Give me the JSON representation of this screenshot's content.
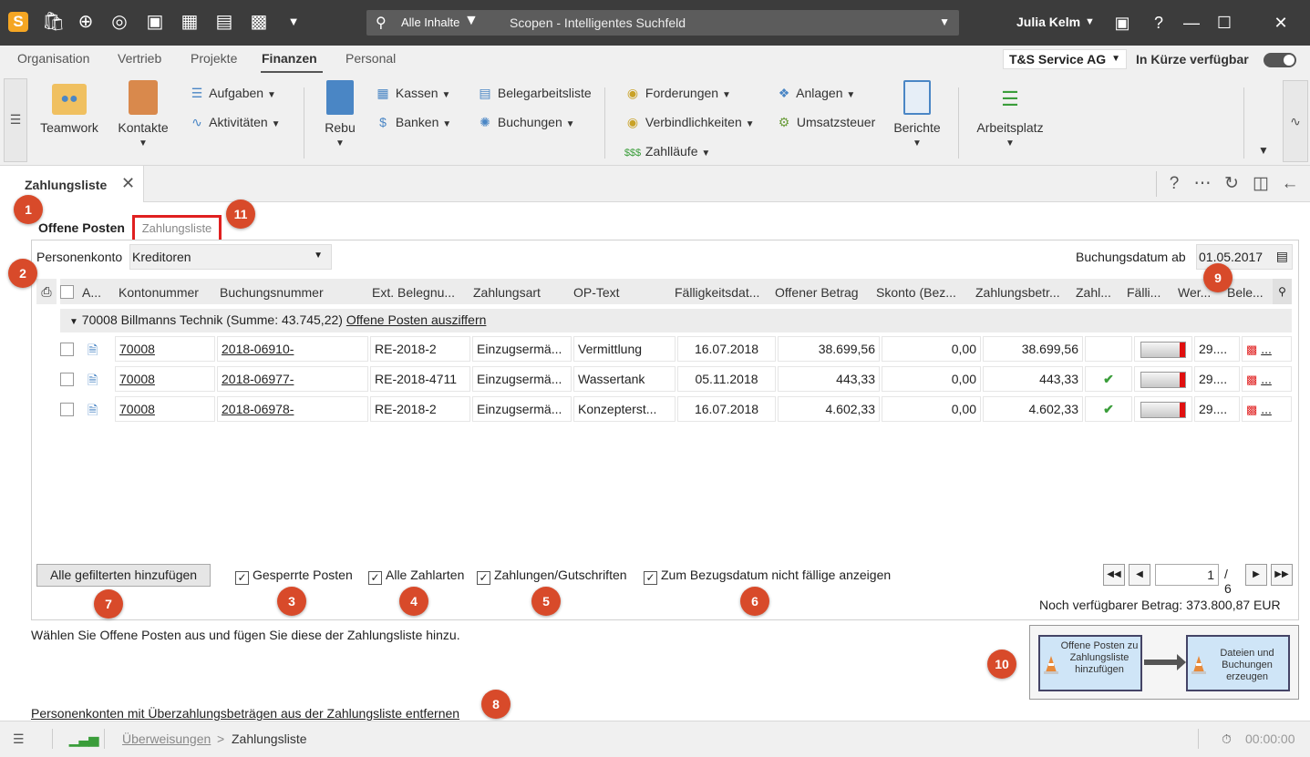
{
  "titlebar": {
    "logo": "S",
    "icons": [
      "bag-icon",
      "plus-circle-icon",
      "lifebuoy-icon",
      "camera-icon",
      "calendar-add-icon",
      "calendar-icon",
      "window-add-icon",
      "dropdown-icon"
    ],
    "search": {
      "scope": "Alle Inhalte",
      "placeholder": "Scopen - Intelligentes Suchfeld"
    },
    "user": "Julia Kelm"
  },
  "navtabs": [
    "Organisation",
    "Vertrieb",
    "Projekte",
    "Finanzen",
    "Personal"
  ],
  "active_navtab": "Finanzen",
  "company": "T&S Service AG",
  "availability": "In Kürze verfügbar",
  "ribbon": {
    "teamwork": "Teamwork",
    "kontakte": "Kontakte",
    "aufgaben": "Aufgaben",
    "aktivitaeten": "Aktivitäten",
    "rebu": "Rebu",
    "kassen": "Kassen",
    "banken": "Banken",
    "belegarbeitsliste": "Belegarbeitsliste",
    "buchungen": "Buchungen",
    "forderungen": "Forderungen",
    "verbindlichkeiten": "Verbindlichkeiten",
    "zahllaeufe": "Zahlläufe",
    "anlagen": "Anlagen",
    "umsatzsteuer": "Umsatzsteuer",
    "berichte": "Berichte",
    "arbeitsplatz": "Arbeitsplatz"
  },
  "doctab": {
    "title": "Zahlungsliste"
  },
  "subtabs": {
    "offene_posten": "Offene Posten",
    "zahlungsliste": "Zahlungsliste"
  },
  "filters": {
    "personenkonto_label": "Personenkonto",
    "personenkonto_value": "Kreditoren",
    "buchungsdatum_label": "Buchungsdatum ab",
    "buchungsdatum_value": "01.05.2017"
  },
  "grid": {
    "headers": [
      "A...",
      "Kontonummer",
      "Buchungsnummer",
      "Ext. Belegnu...",
      "Zahlungsart",
      "OP-Text",
      "Fälligkeitsdat...",
      "Offener Betrag",
      "Skonto (Bez...",
      "Zahlungsbetr...",
      "Zahl...",
      "Fälli...",
      "Wer...",
      "Bele..."
    ],
    "group": {
      "label": "70008 Billmanns Technik (Summe: 43.745,22)",
      "action": "Offene Posten ausziffern"
    },
    "rows": [
      {
        "konto": "70008",
        "buchung": "2018-06910-",
        "beleg": "RE-2018-2",
        "zahlungsart": "Einzugsermä...",
        "optext": "Vermittlung",
        "faellig": "16.07.2018",
        "offen": "38.699,56",
        "skonto": "0,00",
        "zahlung": "38.699,56",
        "zahl": "",
        "wert": "29....",
        "bele": "..."
      },
      {
        "konto": "70008",
        "buchung": "2018-06977-",
        "beleg": "RE-2018-4711",
        "zahlungsart": "Einzugsermä...",
        "optext": "Wassertank",
        "faellig": "05.11.2018",
        "offen": "443,33",
        "skonto": "0,00",
        "zahlung": "443,33",
        "zahl": "✔",
        "wert": "29....",
        "bele": "..."
      },
      {
        "konto": "70008",
        "buchung": "2018-06978-",
        "beleg": "RE-2018-2",
        "zahlungsart": "Einzugsermä...",
        "optext": "Konzepterst...",
        "faellig": "16.07.2018",
        "offen": "4.602,33",
        "skonto": "0,00",
        "zahlung": "4.602,33",
        "zahl": "✔",
        "wert": "29....",
        "bele": "..."
      }
    ]
  },
  "actions": {
    "add_filtered": "Alle gefilterten hinzufügen",
    "gesperrte": "Gesperrte Posten",
    "alle_zahlarten": "Alle Zahlarten",
    "zahlungen": "Zahlungen/Gutschriften",
    "nicht_faellige": "Zum Bezugsdatum nicht fällige anzeigen"
  },
  "pager": {
    "page": "1",
    "total": "/ 6"
  },
  "rest": "Noch verfügbarer Betrag: 373.800,87 EUR",
  "hint": "Wählen Sie Offene Posten aus und fügen Sie diese der Zahlungsliste hinzu.",
  "remove_link": "Personenkonten mit Überzahlungsbeträgen aus der Zahlungsliste entfernen",
  "flow": {
    "step1": "Offene Posten zu Zahlungsliste hinzufügen",
    "step2": "Dateien und Buchungen erzeugen"
  },
  "badges": [
    "1",
    "2",
    "3",
    "4",
    "5",
    "6",
    "7",
    "8",
    "9",
    "10",
    "11"
  ],
  "statusbar": {
    "crumb_link": "Überweisungen",
    "crumb_sep": ">",
    "crumb_current": "Zahlungsliste",
    "timer": "00:00:00"
  },
  "colors": {
    "titlebar": "#3c3c3c",
    "badge": "#d84a2a",
    "highlight_border": "#e02020",
    "logo": "#f5a623"
  }
}
